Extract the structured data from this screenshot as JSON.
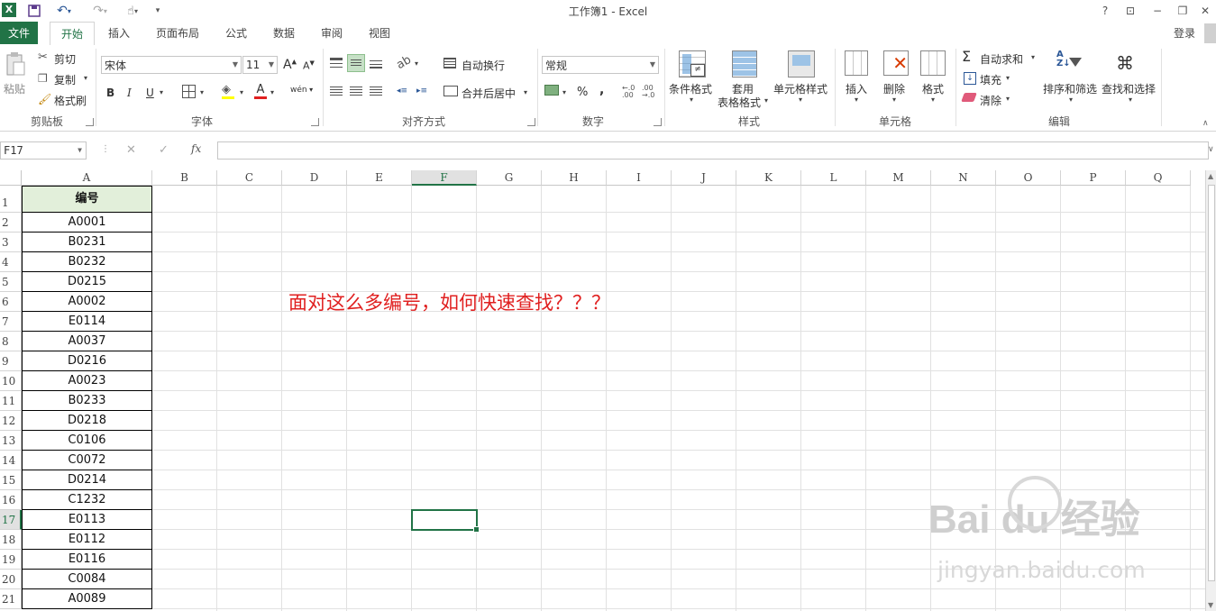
{
  "window": {
    "title": "工作簿1 - Excel",
    "help": "?",
    "restore_ribbon": "⊡",
    "minimize": "−",
    "maximize": "❐",
    "close": "✕",
    "login": "登录"
  },
  "tabs": [
    "文件",
    "开始",
    "插入",
    "页面布局",
    "公式",
    "数据",
    "审阅",
    "视图"
  ],
  "ribbon": {
    "clipboard": {
      "paste": "粘贴",
      "cut": "剪切",
      "copy": "复制",
      "format_painter": "格式刷",
      "label": "剪贴板"
    },
    "font": {
      "name": "宋体",
      "size": "11",
      "bold": "B",
      "italic": "I",
      "underline": "U",
      "label": "字体",
      "grow": "A",
      "shrink": "A",
      "font_color": "A",
      "phonetic": "wén"
    },
    "alignment": {
      "wrap": "自动换行",
      "merge": "合并后居中",
      "label": "对齐方式"
    },
    "number": {
      "format": "常规",
      "percent": "%",
      "comma": ",",
      "label": "数字"
    },
    "styles": {
      "conditional": "条件格式",
      "table_line1": "套用",
      "table_line2": "表格格式",
      "cell_styles": "单元格样式",
      "label": "样式"
    },
    "cells": {
      "insert": "插入",
      "delete": "删除",
      "format": "格式",
      "label": "单元格"
    },
    "editing": {
      "autosum": "自动求和",
      "fill": "填充",
      "clear": "清除",
      "sort": "排序和筛选",
      "find": "查找和选择",
      "label": "编辑"
    }
  },
  "formula_bar": {
    "name_box": "F17",
    "cancel": "✕",
    "enter": "✓",
    "fx": "fx",
    "value": ""
  },
  "columns": [
    "A",
    "B",
    "C",
    "D",
    "E",
    "F",
    "G",
    "H",
    "I",
    "J",
    "K",
    "L",
    "M",
    "N",
    "O",
    "P",
    "Q"
  ],
  "selected_column": "F",
  "selected_row": 17,
  "rows": [
    "1",
    "2",
    "3",
    "4",
    "5",
    "6",
    "7",
    "8",
    "9",
    "10",
    "11",
    "12",
    "13",
    "14",
    "15",
    "16",
    "17",
    "18",
    "19",
    "20",
    "21"
  ],
  "column_a": {
    "header": "编号",
    "values": [
      "A0001",
      "B0231",
      "B0232",
      "D0215",
      "A0002",
      "E0114",
      "A0037",
      "D0216",
      "A0023",
      "B0233",
      "D0218",
      "C0106",
      "C0072",
      "D0214",
      "C1232",
      "E0113",
      "E0112",
      "E0116",
      "C0084",
      "A0089"
    ]
  },
  "annotation": "面对这么多编号，如何快速查找？？？",
  "watermark": {
    "logo": "Bai du 经验",
    "url": "jingyan.baidu.com"
  },
  "colors": {
    "accent": "#217346",
    "annotation": "#e02020"
  }
}
